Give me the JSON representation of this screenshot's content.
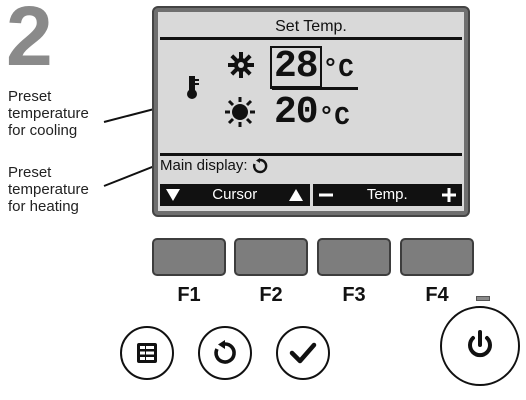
{
  "step": {
    "number": "2"
  },
  "callouts": {
    "cooling": "Preset\ntemperature\nfor cooling",
    "heating": "Preset\ntemperature\nfor heating"
  },
  "lcd": {
    "title": "Set Temp.",
    "cool_temp": "28",
    "cool_unit": "°C",
    "heat_temp": "20",
    "heat_unit": "°C",
    "main_display_label": "Main display:",
    "softkeys": {
      "cursor_label": "Cursor",
      "temp_label": "Temp."
    }
  },
  "function_keys": [
    "F1",
    "F2",
    "F3",
    "F4"
  ],
  "icons": {
    "thermometer": "thermometer-icon",
    "cooling": "snowflake-icon",
    "heating": "sun-icon",
    "return": "return-icon",
    "menu": "menu-icon",
    "select": "checkmark-icon",
    "power": "power-icon"
  },
  "colors": {
    "lcd_background": "#d9d9d9",
    "function_key": "#7d7d7d",
    "step_number": "#8a8a8a"
  }
}
